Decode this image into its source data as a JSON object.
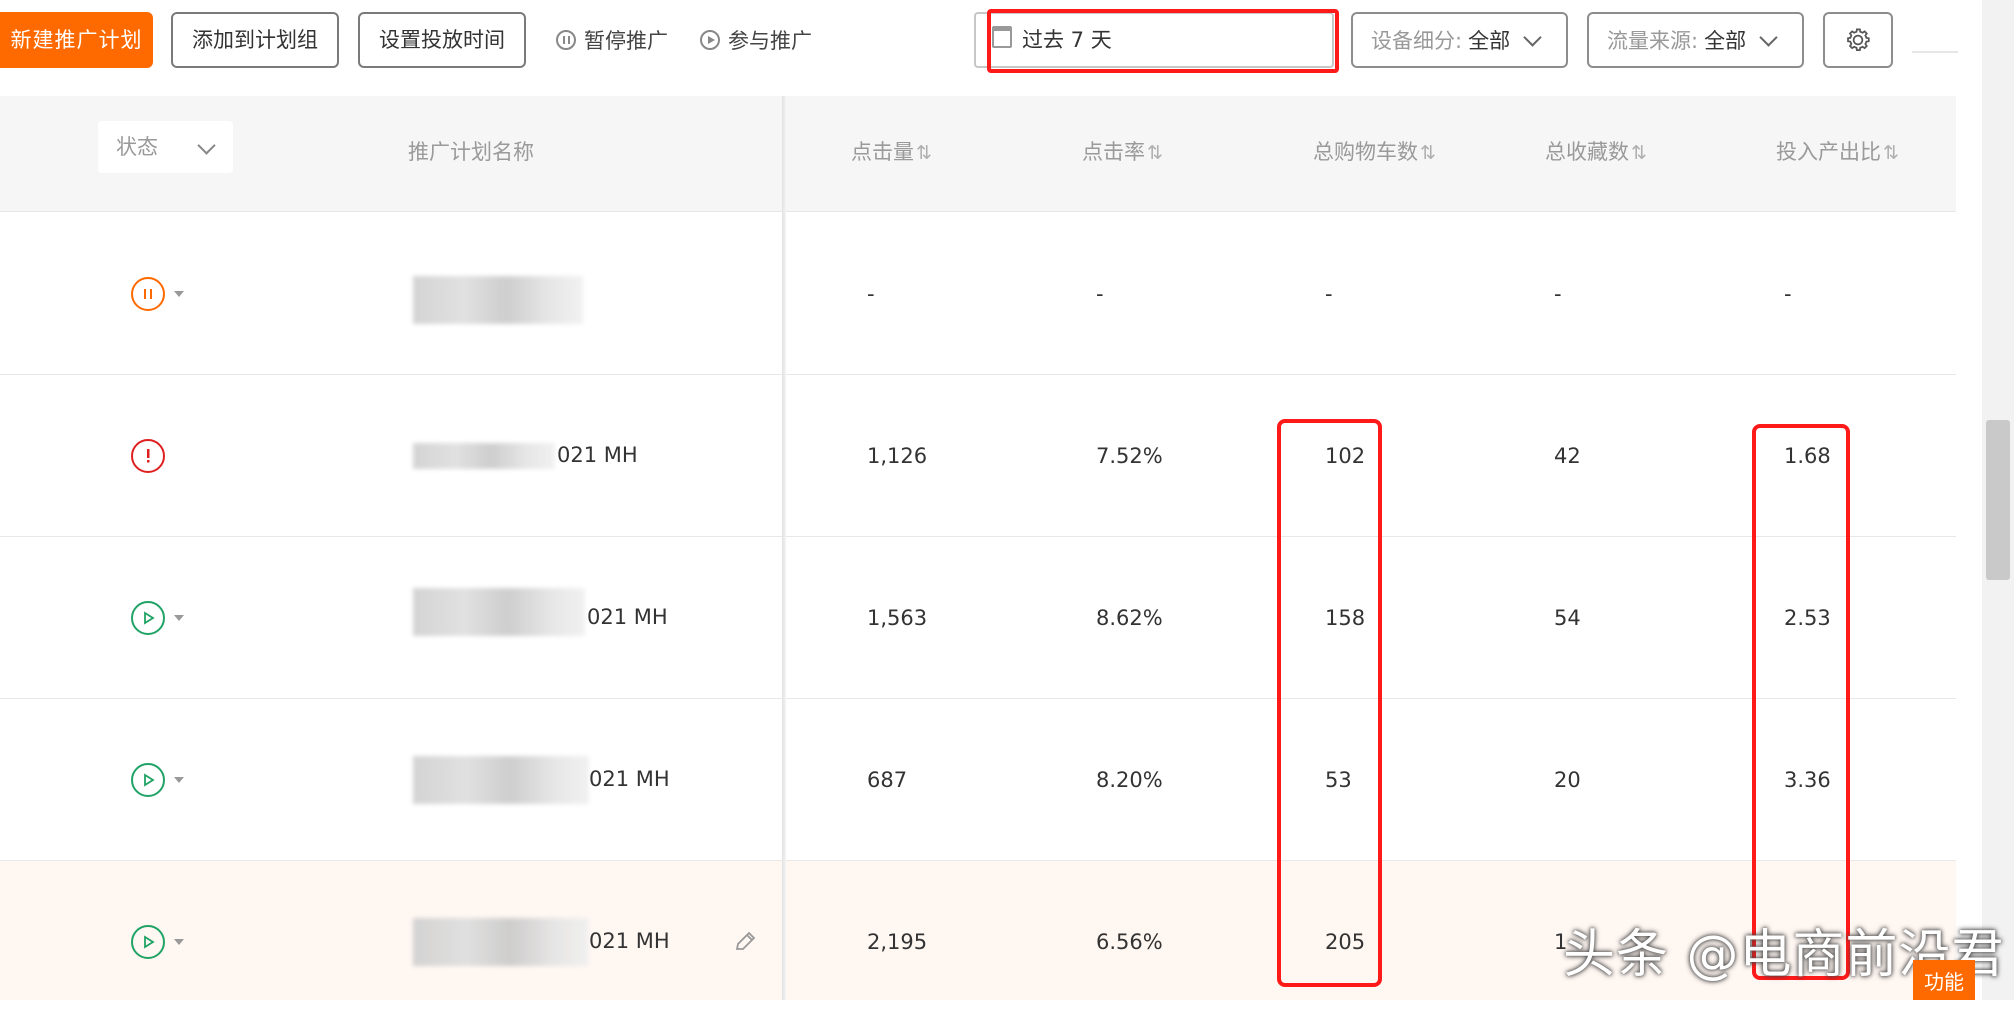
{
  "toolbar": {
    "new_plan_label": "新建推广计划",
    "add_to_group_label": "添加到计划组",
    "set_time_label": "设置投放时间",
    "pause_label": "暂停推广",
    "join_label": "参与推广",
    "date_range": "过去 7 天",
    "device_filter": {
      "label": "设备细分:",
      "value": "全部"
    },
    "traffic_filter": {
      "label": "流量来源:",
      "value": "全部"
    },
    "settings_icon": "gear-icon"
  },
  "table": {
    "status_filter_label": "状态",
    "headers": {
      "name": "推广计划名称",
      "clicks": "点击量",
      "ctr": "点击率",
      "carts": "总购物车数",
      "favorites": "总收藏数",
      "roi": "投入产出比"
    },
    "sort_icon": "⇅",
    "rows": [
      {
        "status": "paused",
        "name": "",
        "clicks": "-",
        "ctr": "-",
        "carts": "-",
        "favorites": "-",
        "roi": "-"
      },
      {
        "status": "warning",
        "name": "021 MH",
        "clicks": "1,126",
        "ctr": "7.52%",
        "carts": "102",
        "favorites": "42",
        "roi": "1.68"
      },
      {
        "status": "active",
        "name": "021 MH",
        "clicks": "1,563",
        "ctr": "8.62%",
        "carts": "158",
        "favorites": "54",
        "roi": "2.53"
      },
      {
        "status": "active",
        "name": "021 MH",
        "clicks": "687",
        "ctr": "8.20%",
        "carts": "53",
        "favorites": "20",
        "roi": "3.36"
      },
      {
        "status": "active",
        "name": "021 MH",
        "clicks": "2,195",
        "ctr": "6.56%",
        "carts": "205",
        "favorites": "1",
        "roi": ""
      }
    ]
  },
  "status_colors": {
    "paused": "#ff6a00",
    "warning": "#e02020",
    "active": "#21a366"
  },
  "accent_color": "#ff6a00",
  "highlight_color": "#ff1a1a",
  "watermark": "头条 @电商前沿君",
  "corner_label": "功能"
}
